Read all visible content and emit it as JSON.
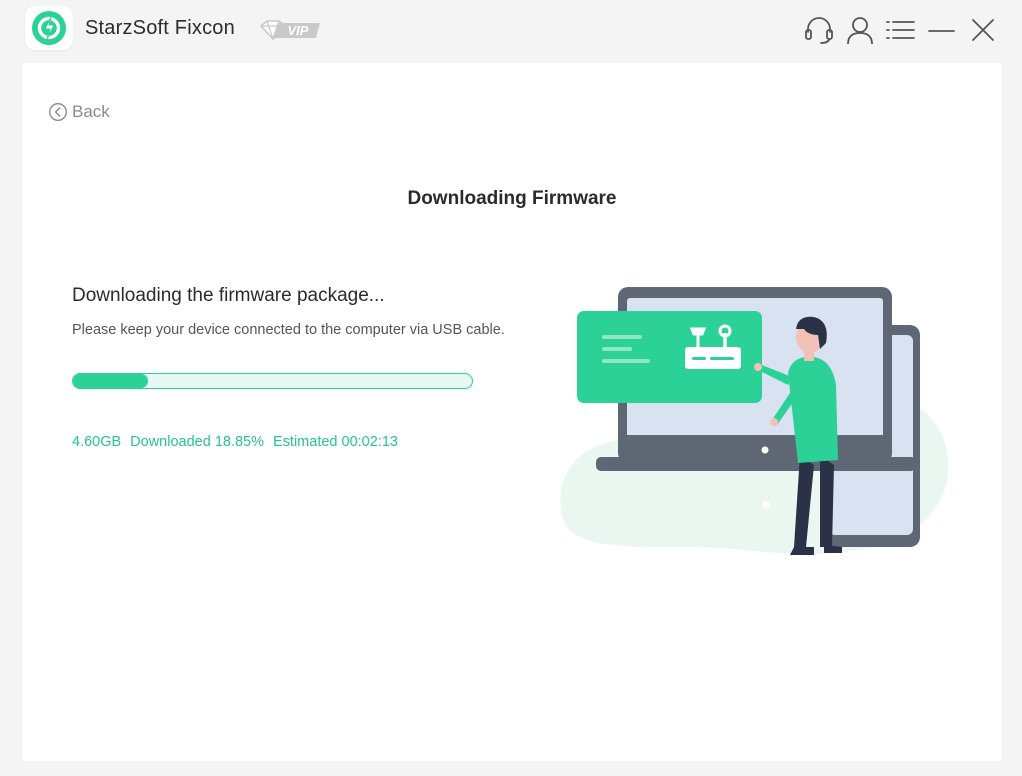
{
  "app": {
    "title": "StarzSoft Fixcon",
    "vip_label": "VIP"
  },
  "titlebar": {
    "icons": [
      "headset-icon",
      "user-icon",
      "menu-icon",
      "minimize-icon",
      "close-icon"
    ]
  },
  "nav": {
    "back_label": "Back"
  },
  "page": {
    "title": "Downloading Firmware",
    "status_heading": "Downloading the firmware package...",
    "status_sub": "Please keep your device connected to the computer via USB cable."
  },
  "progress": {
    "percent": 18.85,
    "size": "4.60GB",
    "downloaded": "Downloaded 18.85%",
    "estimated": "Estimated 00:02:13"
  },
  "colors": {
    "accent": "#2bd197",
    "accent_light": "#e6faf3",
    "stats_text": "#26c48e"
  }
}
